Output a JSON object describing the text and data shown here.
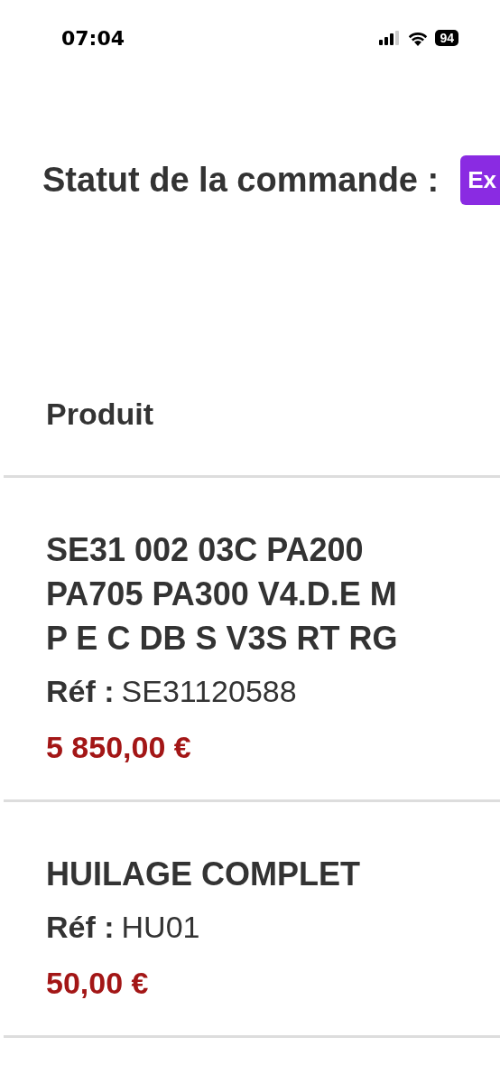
{
  "status_bar": {
    "time": "07:04",
    "battery": "94"
  },
  "order_status": {
    "label": "Statut de la commande :",
    "badge": "Ex"
  },
  "table": {
    "column_header": "Produit",
    "rows": [
      {
        "name": "SE31 002 03C PA200 PA705 PA300 V4.D.E M P E C DB S V3S RT RG",
        "ref_label": "Réf :",
        "ref": "SE31120588",
        "price": "5 850,00 €"
      },
      {
        "name": "HUILAGE COMPLET",
        "ref_label": "Réf :",
        "ref": "HU01",
        "price": "50,00 €"
      }
    ]
  }
}
